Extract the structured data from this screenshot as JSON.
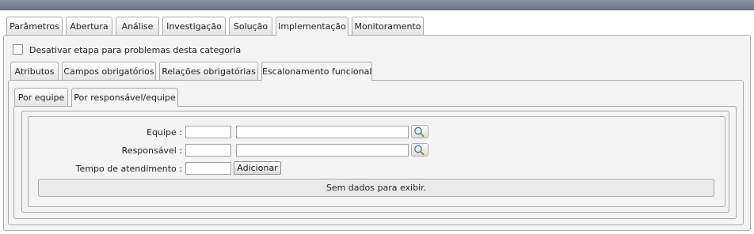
{
  "main_tabs": [
    {
      "label": "Parâmetros"
    },
    {
      "label": "Abertura"
    },
    {
      "label": "Análise"
    },
    {
      "label": "Investigação"
    },
    {
      "label": "Solução"
    },
    {
      "label": "Implementação",
      "selected": true
    },
    {
      "label": "Monitoramento"
    }
  ],
  "disable_step": {
    "label": "Desativar etapa para problemas desta categoria",
    "checked": false
  },
  "sub_tabs": [
    {
      "label": "Atributos"
    },
    {
      "label": "Campos obrigatórios"
    },
    {
      "label": "Relações obrigatórias"
    },
    {
      "label": "Escalonamento funcional",
      "selected": true
    }
  ],
  "escalation_tabs": [
    {
      "label": "Por equipe"
    },
    {
      "label": "Por responsável/equipe",
      "selected": true
    }
  ],
  "form": {
    "team_label": "Equipe :",
    "team_code": "",
    "team_name": "",
    "responsible_label": "Responsável :",
    "responsible_code": "",
    "responsible_name": "",
    "time_label": "Tempo de atendimento :",
    "time_value": "",
    "add_button": "Adicionar",
    "lookup_icon": "magnifier-icon"
  },
  "table": {
    "empty_message": "Sem dados para exibir."
  }
}
